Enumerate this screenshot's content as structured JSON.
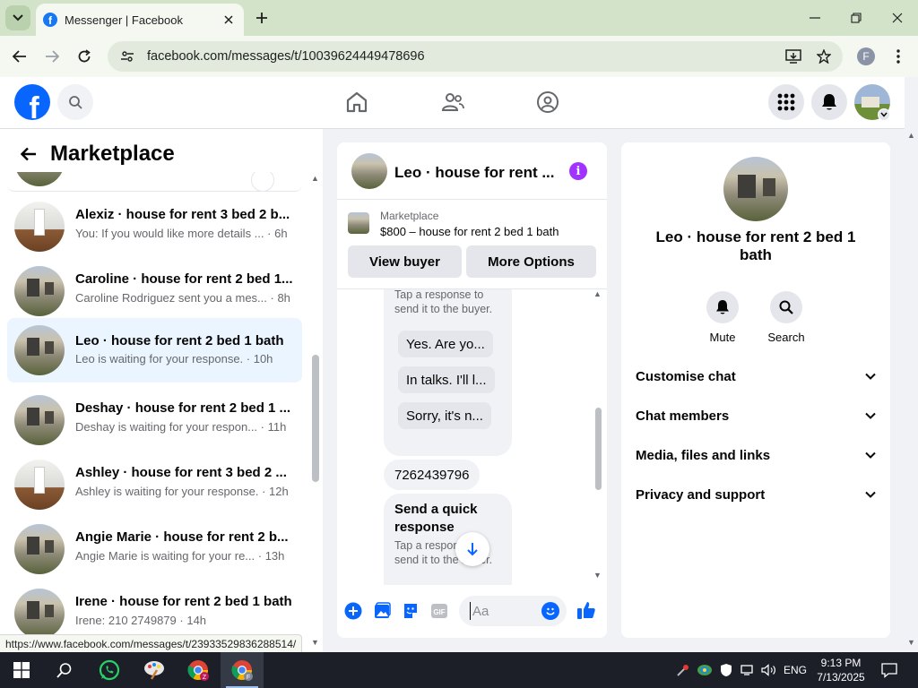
{
  "browser": {
    "tab_title": "Messenger | Facebook",
    "url": "facebook.com/messages/t/10039624449478696",
    "profile_initial": "F",
    "status_url": "https://www.facebook.com/messages/t/23933529836288514/"
  },
  "sidebar": {
    "title": "Marketplace",
    "conversations": [
      {
        "name": "Alexiz · house for rent 3 bed 2 b...",
        "preview": "You: If you would like more details ...",
        "time": "6h",
        "avatar": "interior"
      },
      {
        "name": "Caroline · house for rent 2 bed 1...",
        "preview": "Caroline Rodriguez sent you a mes...",
        "time": "8h",
        "avatar": "exterior"
      },
      {
        "name": "Leo · house for rent 2 bed 1 bath",
        "preview": "Leo is waiting for your response.",
        "time": "10h",
        "avatar": "exterior",
        "active": true
      },
      {
        "name": "Deshay · house for rent 2 bed 1 ...",
        "preview": "Deshay is waiting for your respon...",
        "time": "11h",
        "avatar": "exterior"
      },
      {
        "name": "Ashley · house for rent 3 bed 2 ...",
        "preview": "Ashley is waiting for your response.",
        "time": "12h",
        "avatar": "interior"
      },
      {
        "name": "Angie Marie · house for rent 2 b...",
        "preview": "Angie Marie is waiting for your re...",
        "time": "13h",
        "avatar": "exterior"
      },
      {
        "name": "Irene · house for rent 2 bed 1 bath",
        "preview": "Irene: 210 2749879",
        "time": "14h",
        "avatar": "exterior"
      }
    ]
  },
  "chat": {
    "header_name": "Leo · house for rent ...",
    "marketplace_label": "Marketplace",
    "listing_title": "$800 – house for rent 2 bed 1 bath",
    "view_buyer": "View buyer",
    "more_options": "More Options",
    "note_top": "Tap a response to send it to the buyer.",
    "quick_replies": [
      "Yes. Are yo...",
      "In talks. I'll l...",
      "Sorry, it's n..."
    ],
    "phone_message": "7262439796",
    "quick_response_title": "Send a quick response",
    "note_bottom": "Tap a response to send it to the buyer.",
    "composer_placeholder": "Aa"
  },
  "info_panel": {
    "name": "Leo · house for rent 2 bed 1 bath",
    "actions": {
      "mute": "Mute",
      "search": "Search"
    },
    "sections": [
      "Customise chat",
      "Chat members",
      "Media, files and links",
      "Privacy and support"
    ]
  },
  "taskbar": {
    "language": "ENG",
    "time": "9:13 PM",
    "date": "7/13/2025"
  }
}
